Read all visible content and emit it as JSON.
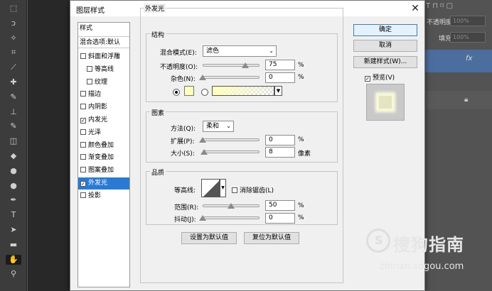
{
  "app": {
    "tools": [
      "marquee-icon",
      "lasso-icon",
      "magic-wand-icon",
      "crop-icon",
      "eyedropper-icon",
      "healing-icon",
      "brush-icon",
      "stamp-icon",
      "history-brush-icon",
      "eraser-icon",
      "bucket-icon",
      "blur-icon",
      "dodge-icon",
      "pen-icon",
      "type-icon",
      "path-select-icon",
      "shape-icon",
      "hand-icon",
      "zoom-icon"
    ],
    "right_panel": {
      "opacity_label": "不透明度:",
      "opacity_value": "100%",
      "fill_label": "填充:",
      "fill_value": "100%",
      "fx_label": "fx"
    }
  },
  "dialog": {
    "title": "图层样式",
    "close": "✕",
    "style_list": {
      "header": "样式",
      "blend_options": "混合选项:默认",
      "items": [
        {
          "label": "斜面和浮雕",
          "checked": false,
          "indent": false
        },
        {
          "label": "等高线",
          "checked": false,
          "indent": true
        },
        {
          "label": "纹理",
          "checked": false,
          "indent": true
        },
        {
          "label": "描边",
          "checked": false,
          "indent": false
        },
        {
          "label": "内阴影",
          "checked": false,
          "indent": false
        },
        {
          "label": "内发光",
          "checked": true,
          "indent": false
        },
        {
          "label": "光泽",
          "checked": false,
          "indent": false
        },
        {
          "label": "颜色叠加",
          "checked": false,
          "indent": false
        },
        {
          "label": "渐变叠加",
          "checked": false,
          "indent": false
        },
        {
          "label": "图案叠加",
          "checked": false,
          "indent": false
        },
        {
          "label": "外发光",
          "checked": true,
          "indent": false,
          "selected": true
        },
        {
          "label": "投影",
          "checked": false,
          "indent": false
        }
      ]
    },
    "panel_title": "外发光",
    "structure": {
      "title": "结构",
      "blend_mode_label": "混合模式(E):",
      "blend_mode_value": "滤色",
      "opacity_label": "不透明度(O):",
      "opacity_value": "75",
      "opacity_level": 0.75,
      "noise_label": "杂色(N):",
      "noise_value": "0",
      "noise_level": 0,
      "percent": "%",
      "color_swatch": "#ffffbe",
      "gradient_start": "#ffffbe"
    },
    "elements": {
      "title": "图素",
      "method_label": "方法(Q):",
      "method_value": "柔和",
      "spread_label": "扩展(P):",
      "spread_value": "0",
      "spread_level": 0,
      "size_label": "大小(S):",
      "size_value": "8",
      "size_level": 0.03,
      "size_unit": "像素",
      "percent": "%"
    },
    "quality": {
      "title": "品质",
      "contour_label": "等高线:",
      "antialias_label": "消除锯齿(L)",
      "range_label": "范围(R):",
      "range_value": "50",
      "range_level": 0.5,
      "jitter_label": "抖动(J):",
      "jitter_value": "0",
      "jitter_level": 0,
      "percent": "%"
    },
    "buttons": {
      "make_default": "设置为默认值",
      "reset_default": "复位为默认值",
      "ok": "确定",
      "cancel": "取消",
      "new_style": "新建样式(W)...",
      "preview_label": "预览(V)",
      "preview_checked": true
    }
  },
  "watermark": {
    "text": "搜狗指南",
    "url": "zhinan.sogou.com"
  }
}
